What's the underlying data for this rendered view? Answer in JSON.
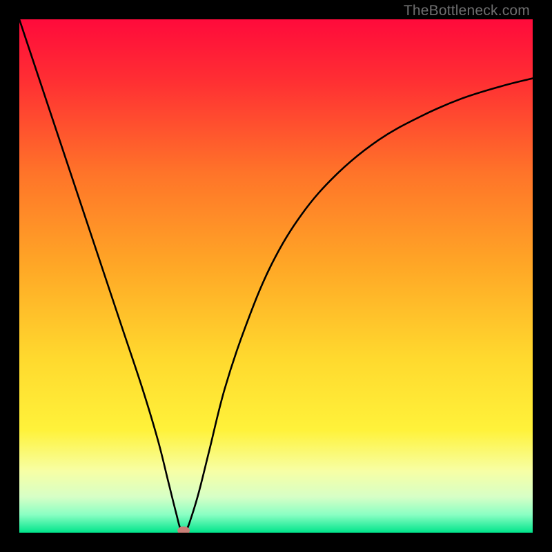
{
  "watermark": "TheBottleneck.com",
  "chart_data": {
    "type": "line",
    "title": "",
    "xlabel": "",
    "ylabel": "",
    "xlim": [
      0,
      100
    ],
    "ylim": [
      0,
      100
    ],
    "grid": false,
    "legend": false,
    "gradient_stops": [
      {
        "offset": 0.0,
        "color": "#ff0a3b"
      },
      {
        "offset": 0.12,
        "color": "#ff2f33"
      },
      {
        "offset": 0.3,
        "color": "#ff7429"
      },
      {
        "offset": 0.48,
        "color": "#ffa726"
      },
      {
        "offset": 0.66,
        "color": "#ffd92e"
      },
      {
        "offset": 0.8,
        "color": "#fff23a"
      },
      {
        "offset": 0.88,
        "color": "#f7ffa5"
      },
      {
        "offset": 0.93,
        "color": "#d7ffc6"
      },
      {
        "offset": 0.965,
        "color": "#8affc3"
      },
      {
        "offset": 1.0,
        "color": "#00e58b"
      }
    ],
    "series": [
      {
        "name": "bottleneck-curve",
        "points": [
          {
            "x": 0.0,
            "y": 100.0
          },
          {
            "x": 4.0,
            "y": 88.0
          },
          {
            "x": 8.0,
            "y": 76.0
          },
          {
            "x": 12.0,
            "y": 64.0
          },
          {
            "x": 16.0,
            "y": 52.0
          },
          {
            "x": 20.0,
            "y": 40.0
          },
          {
            "x": 24.0,
            "y": 28.0
          },
          {
            "x": 27.0,
            "y": 18.0
          },
          {
            "x": 29.0,
            "y": 10.0
          },
          {
            "x": 30.5,
            "y": 4.0
          },
          {
            "x": 31.5,
            "y": 0.5
          },
          {
            "x": 32.5,
            "y": 0.5
          },
          {
            "x": 33.5,
            "y": 3.0
          },
          {
            "x": 35.0,
            "y": 8.0
          },
          {
            "x": 37.0,
            "y": 16.0
          },
          {
            "x": 40.0,
            "y": 28.0
          },
          {
            "x": 44.0,
            "y": 40.0
          },
          {
            "x": 49.0,
            "y": 52.0
          },
          {
            "x": 55.0,
            "y": 62.0
          },
          {
            "x": 62.0,
            "y": 70.0
          },
          {
            "x": 70.0,
            "y": 76.5
          },
          {
            "x": 78.0,
            "y": 81.0
          },
          {
            "x": 86.0,
            "y": 84.5
          },
          {
            "x": 94.0,
            "y": 87.0
          },
          {
            "x": 100.0,
            "y": 88.5
          }
        ]
      }
    ],
    "marker": {
      "x": 32.0,
      "y": 0.0,
      "rx": 1.2,
      "ry": 0.8,
      "color": "#c97f77"
    }
  }
}
